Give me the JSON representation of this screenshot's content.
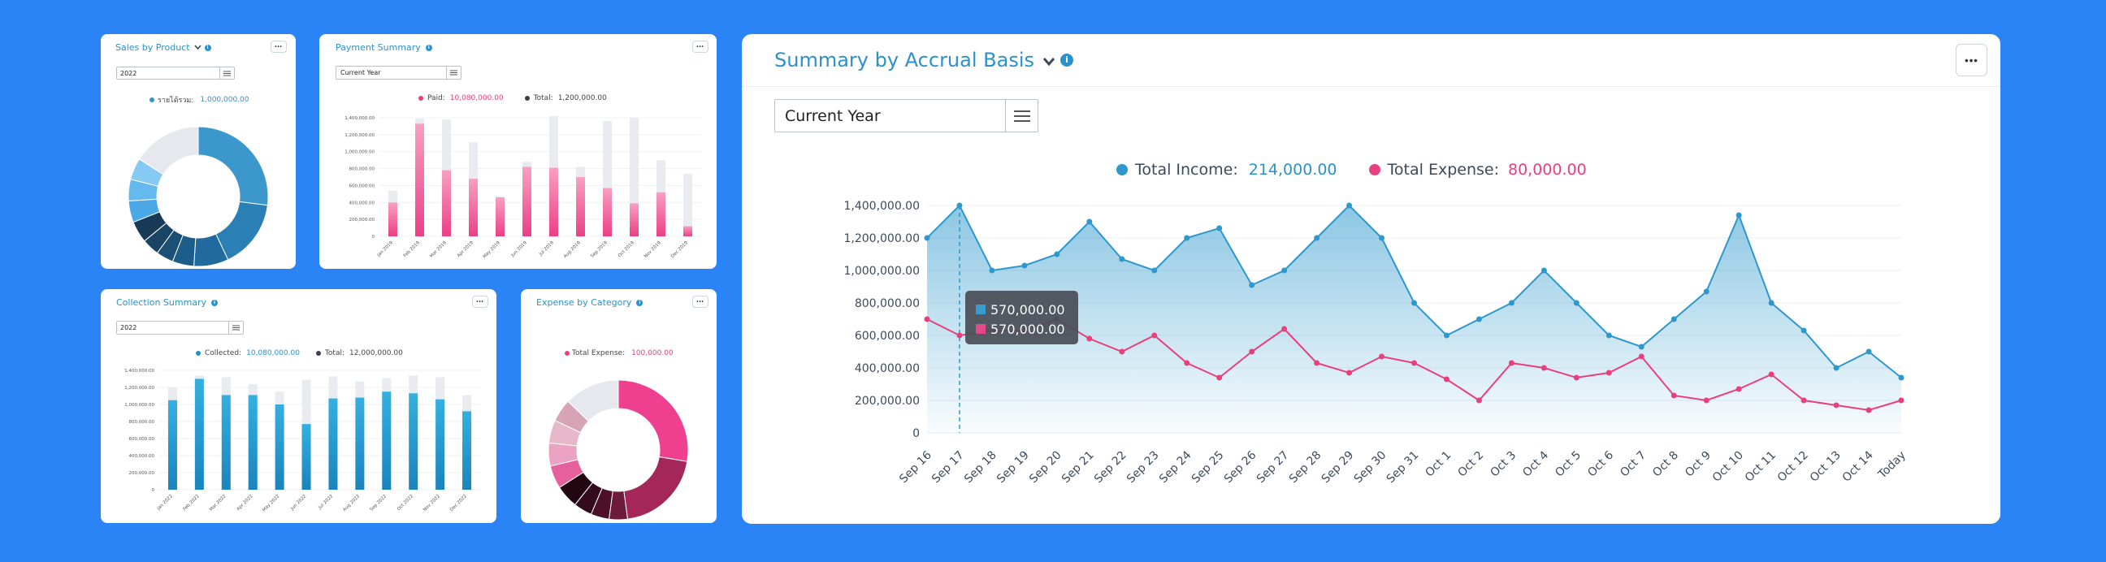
{
  "colors": {
    "background": "#2b84f5",
    "accent": "#2b91c9",
    "income": "#2e98cc",
    "expense": "#e8407f",
    "paid": "#f06a9b",
    "collected": "#1e95c8",
    "remaining": "#e6e8ee",
    "tooltip_bg": "#4b4f58"
  },
  "sales_card": {
    "title": "Sales by Product",
    "chevron_icon": "chevron-down-icon",
    "info_icon": "info-icon",
    "menu": "•••",
    "year": "2022",
    "legend_label": "รายได้รวม:",
    "legend_value": "1,000,000.00"
  },
  "payment_card": {
    "title": "Payment Summary",
    "menu": "•••",
    "period": "Current Year",
    "legend_paid_label": "Paid:",
    "legend_paid_value": "10,080,000.00",
    "legend_total_label": "Total:",
    "legend_total_value": "1,200,000.00"
  },
  "collection_card": {
    "title": "Collection Summary",
    "menu": "•••",
    "year": "2022",
    "legend_collected_label": "Collected:",
    "legend_collected_value": "10,080,000.00",
    "legend_total_label": "Total:",
    "legend_total_value": "12,000,000.00"
  },
  "expense_card": {
    "title": "Expense by Category",
    "menu": "•••",
    "legend_label": "Total Expense:",
    "legend_value": "100,000.00"
  },
  "accrual_card": {
    "title": "Summary by Accrual Basis",
    "menu": "•••",
    "period": "Current Year",
    "legend_income_label": "Total Income:",
    "legend_income_value": "214,000.00",
    "legend_expense_label": "Total Expense:",
    "legend_expense_value": "80,000.00",
    "tooltip_income": "570,000.00",
    "tooltip_expense": "570,000.00"
  },
  "chart_data": [
    {
      "id": "sales_by_product",
      "type": "pie",
      "donut": true,
      "slices": [
        {
          "value": 27,
          "color": "#3c98cc"
        },
        {
          "value": 16,
          "color": "#2a7fb5"
        },
        {
          "value": 8,
          "color": "#206a9e"
        },
        {
          "value": 5,
          "color": "#1d5d8a"
        },
        {
          "value": 4,
          "color": "#1c4f76"
        },
        {
          "value": 4,
          "color": "#1a4465"
        },
        {
          "value": 5,
          "color": "#183a57"
        },
        {
          "value": 5,
          "color": "#4aa9e6"
        },
        {
          "value": 5,
          "color": "#64b9ee"
        },
        {
          "value": 5,
          "color": "#86c9f3"
        },
        {
          "value": 16,
          "color": "#e6e8ee"
        }
      ]
    },
    {
      "id": "payment_summary",
      "type": "bar",
      "stacked": true,
      "categories": [
        "Jan 2019",
        "Feb 2019",
        "Mar 2019",
        "Apr 2019",
        "May 2019",
        "Jun 2019",
        "Jul 2019",
        "Aug 2019",
        "Sep 2019",
        "Oct 2019",
        "Nov 2019",
        "Dec 2019"
      ],
      "series": [
        {
          "name": "Paid",
          "values": [
            400000,
            1330000,
            780000,
            680000,
            460000,
            820000,
            810000,
            700000,
            570000,
            390000,
            520000,
            120000
          ]
        },
        {
          "name": "Total",
          "values": [
            540000,
            1390000,
            1380000,
            1110000,
            470000,
            880000,
            1420000,
            820000,
            1360000,
            1400000,
            900000,
            740000
          ]
        }
      ],
      "yticks": [
        "0",
        "200,000.00",
        "400,000.00",
        "600,000.00",
        "800,000.00",
        "1,000,000.00",
        "1,200,000.00",
        "1,400,000.00"
      ],
      "ylim": [
        0,
        1400000
      ]
    },
    {
      "id": "collection_summary",
      "type": "bar",
      "stacked": true,
      "categories": [
        "Jan 2022",
        "Feb 2022",
        "Mar 2022",
        "Apr 2022",
        "May 2022",
        "Jun 2022",
        "Jul 2022",
        "Aug 2022",
        "Sep 2022",
        "Oct 2022",
        "Nov 2022",
        "Dec 2022"
      ],
      "series": [
        {
          "name": "Collected",
          "values": [
            1050000,
            1300000,
            1110000,
            1110000,
            1000000,
            770000,
            1070000,
            1080000,
            1150000,
            1130000,
            1060000,
            920000
          ]
        },
        {
          "name": "Total",
          "values": [
            1200000,
            1340000,
            1320000,
            1240000,
            1150000,
            1290000,
            1330000,
            1270000,
            1310000,
            1340000,
            1320000,
            1110000
          ]
        }
      ],
      "yticks": [
        "0",
        "200,000.00",
        "400,000.00",
        "600,000.00",
        "800,000.00",
        "1,000,000.00",
        "1,200,000.00",
        "1,400,000.00"
      ],
      "ylim": [
        0,
        1400000
      ]
    },
    {
      "id": "expense_by_category",
      "type": "pie",
      "donut": true,
      "slices": [
        {
          "value": 26,
          "color": "#ef3f8f"
        },
        {
          "value": 19,
          "color": "#a52659"
        },
        {
          "value": 4,
          "color": "#6d1b3b"
        },
        {
          "value": 4,
          "color": "#4d1028"
        },
        {
          "value": 4,
          "color": "#340b1b"
        },
        {
          "value": 5,
          "color": "#230710"
        },
        {
          "value": 5,
          "color": "#e6609d"
        },
        {
          "value": 5,
          "color": "#eca3c3"
        },
        {
          "value": 5,
          "color": "#e7b8c9"
        },
        {
          "value": 5,
          "color": "#d6a4b5"
        },
        {
          "value": 12,
          "color": "#e6e8ee"
        }
      ]
    },
    {
      "id": "summary_by_accrual_basis",
      "type": "area",
      "categories": [
        "Sep 16",
        "Sep 17",
        "Sep 18",
        "Sep 19",
        "Sep 20",
        "Sep 21",
        "Sep 22",
        "Sep 23",
        "Sep 24",
        "Sep 25",
        "Sep 26",
        "Sep 27",
        "Sep 28",
        "Sep 29",
        "Sep 30",
        "Sep 31",
        "Oct 1",
        "Oct 2",
        "Oct 3",
        "Oct 4",
        "Oct 5",
        "Oct 6",
        "Oct 7",
        "Oct 8",
        "Oct 9",
        "Oct 10",
        "Oct 11",
        "Oct 12",
        "Oct 13",
        "Oct 14",
        "Today"
      ],
      "series": [
        {
          "name": "Total Income",
          "values": [
            1200000,
            1400000,
            1000000,
            1030000,
            1100000,
            1300000,
            1070000,
            1000000,
            1200000,
            1260000,
            910000,
            1000000,
            1200000,
            1400000,
            1200000,
            800000,
            600000,
            700000,
            800000,
            1000000,
            800000,
            600000,
            530000,
            700000,
            870000,
            1340000,
            800000,
            630000,
            400000,
            500000,
            340000
          ]
        },
        {
          "name": "Total Expense",
          "values": [
            700000,
            600000,
            630000,
            630000,
            700000,
            580000,
            500000,
            600000,
            430000,
            340000,
            500000,
            640000,
            430000,
            370000,
            470000,
            430000,
            330000,
            200000,
            430000,
            400000,
            340000,
            370000,
            470000,
            230000,
            200000,
            270000,
            360000,
            200000,
            170000,
            140000,
            200000
          ]
        }
      ],
      "yticks": [
        "0",
        "200,000.00",
        "400,000.00",
        "600,000.00",
        "800,000.00",
        "1,000,000.00",
        "1,200,000.00",
        "1,400,000.00"
      ],
      "ylim": [
        0,
        1400000
      ],
      "highlight_index": 1
    }
  ]
}
